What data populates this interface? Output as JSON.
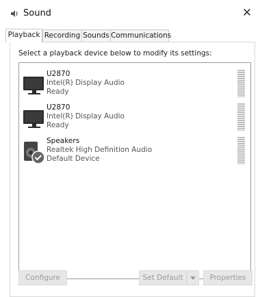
{
  "window": {
    "title": "Sound",
    "close_glyph": "✕"
  },
  "tabs": [
    {
      "label": "Playback",
      "active": true
    },
    {
      "label": "Recording",
      "active": false
    },
    {
      "label": "Sounds",
      "active": false
    },
    {
      "label": "Communications",
      "active": false
    }
  ],
  "instruction": "Select a playback device below to modify its settings:",
  "devices": [
    {
      "name": "U2870",
      "driver": "Intel(R) Display Audio",
      "status": "Ready",
      "icon": "monitor-icon"
    },
    {
      "name": "U2870",
      "driver": "Intel(R) Display Audio",
      "status": "Ready",
      "icon": "monitor-icon"
    },
    {
      "name": "Speakers",
      "driver": "Realtek High Definition Audio",
      "status": "Default Device",
      "icon": "speaker-icon",
      "default": true
    }
  ],
  "buttons": {
    "configure": "Configure",
    "set_default": "Set Default",
    "properties": "Properties"
  }
}
